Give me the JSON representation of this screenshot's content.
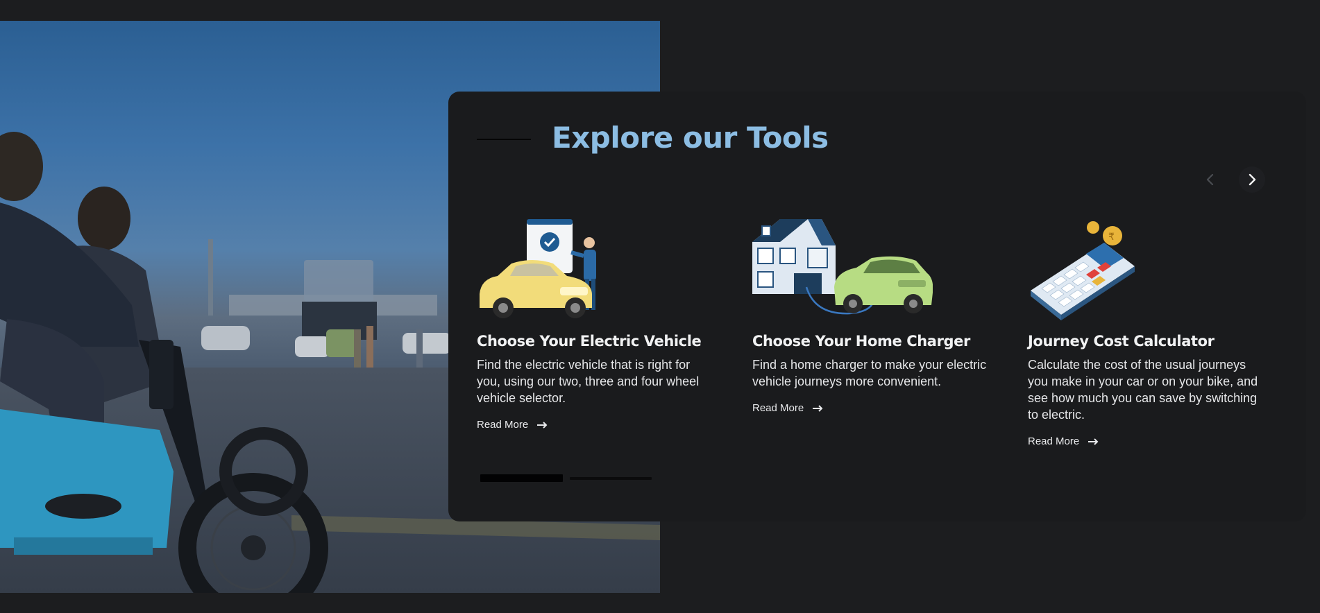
{
  "section": {
    "title": "Explore our Tools"
  },
  "carousel": {
    "progress": 0.5
  },
  "tools": [
    {
      "title": "Choose Your Electric Vehicle",
      "description": "Find the electric vehicle that is right for you, using our two, three and four wheel vehicle selector.",
      "link_label": "Read More",
      "icon": "ev-selector-illustration"
    },
    {
      "title": "Choose Your Home Charger",
      "description": "Find a home charger to make your electric vehicle journeys more convenient.",
      "link_label": "Read More",
      "icon": "home-charger-illustration"
    },
    {
      "title": "Journey Cost Calculator",
      "description": "Calculate the cost of the usual journeys you make in your car or on your bike, and see how much you can save by switching to electric.",
      "link_label": "Read More",
      "icon": "calculator-illustration"
    }
  ],
  "colors": {
    "page_background": "#1c1d1f",
    "card_background": "#1a1b1d",
    "title_accent": "#8cbde3",
    "text": "#e6e7e9"
  }
}
